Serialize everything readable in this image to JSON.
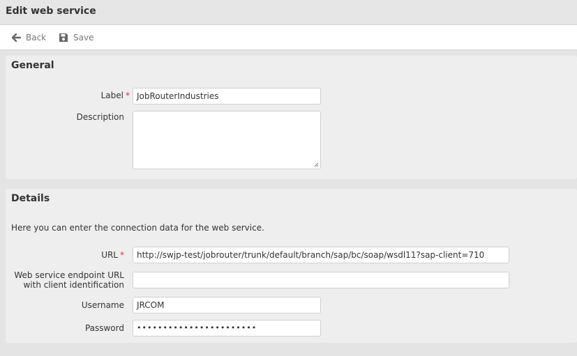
{
  "header": {
    "title": "Edit web service"
  },
  "toolbar": {
    "back_label": "Back",
    "save_label": "Save"
  },
  "general": {
    "heading": "General",
    "label_field": {
      "label": "Label",
      "required_mark": "*",
      "value": "JobRouterIndustries"
    },
    "description_field": {
      "label": "Description",
      "value": ""
    }
  },
  "details": {
    "heading": "Details",
    "intro": "Here you can enter the connection data for the web service.",
    "url_field": {
      "label": "URL",
      "required_mark": "*",
      "value": "http://swjp-test/jobrouter/trunk/default/branch/sap/bc/soap/wsdl11?sap-client=710"
    },
    "endpoint_field": {
      "label_line1": "Web service endpoint URL",
      "label_line2": "with client identification",
      "value": ""
    },
    "username_field": {
      "label": "Username",
      "value": "JRCOM"
    },
    "password_field": {
      "label": "Password",
      "value": "•••••••••••••••••••••••"
    }
  },
  "colors": {
    "required": "#d9342b",
    "panel_bg": "#eeeeee",
    "page_bg": "#e4e4e4"
  },
  "icons": {
    "back": "arrow-left-icon",
    "save": "floppy-disk-icon"
  }
}
